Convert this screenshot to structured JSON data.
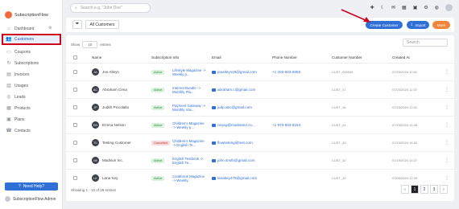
{
  "app": {
    "name": "SubscriptionFlow"
  },
  "sidebar": {
    "items": [
      {
        "label": "Dashboard",
        "icon": "home-icon"
      },
      {
        "label": "Customers",
        "icon": "users-icon",
        "active": true
      },
      {
        "label": "Coupons",
        "icon": "coupon-icon"
      },
      {
        "label": "Subscriptions",
        "icon": "subscriptions-icon"
      },
      {
        "label": "Invoices",
        "icon": "invoice-icon"
      },
      {
        "label": "Usages",
        "icon": "usage-icon"
      },
      {
        "label": "Leads",
        "icon": "leads-icon"
      },
      {
        "label": "Products",
        "icon": "products-icon"
      },
      {
        "label": "Plans",
        "icon": "plans-icon"
      },
      {
        "label": "Contacts",
        "icon": "contacts-icon"
      }
    ],
    "help_label": "Need Help?",
    "admin_name": "SubscriptionFlow Admin"
  },
  "topbar": {
    "search_placeholder": "Search e.g. \"John Doe\""
  },
  "toolbar": {
    "all_customers": "All Customers",
    "create_customer": "Create Customer",
    "import": "Import",
    "more": "More"
  },
  "table": {
    "show_label": "Show",
    "show_value": "10",
    "entries_label": "entries",
    "search_placeholder": "Search",
    "columns": [
      "Name",
      "Subscription Info",
      "Email",
      "Phone Number",
      "Customer Number",
      "Created At"
    ],
    "rows": [
      {
        "initials": "JA",
        "name": "Joe Alleyn",
        "status": "Active",
        "status_class": "active",
        "sub": "Lifestyle Magazine -> Weekly p...",
        "email": "joealleyn15@gmail.com",
        "phone": "+1 203-503-5050",
        "number": "CUST_000049",
        "created": "07/23/2024 10:51"
      },
      {
        "initials": "AC",
        "name": "Abraham Cena",
        "status": "Active",
        "status_class": "active",
        "sub": "Internet Bundle -> Monthly Pla...",
        "email": "abraham.c@gmail.com",
        "phone": "",
        "number": "CUST_47",
        "created": "07/23/2024 12:37"
      },
      {
        "initials": "JP",
        "name": "Judith Piccolalla",
        "status": "Active",
        "status_class": "active",
        "sub": "Payment Gateway -> Monthly Vas...",
        "email": "judp.abc@gmail.com",
        "phone": "",
        "number": "CUST_46",
        "created": "07/23/2024 12:31"
      },
      {
        "initials": "EN",
        "name": "Emma Nelson",
        "status": "Active",
        "status_class": "active",
        "sub": "Children's Magazine -> Weekly p...",
        "email": "neyeg@mailinator.co...",
        "phone": "+1 973-503-9164",
        "number": "CUST_44",
        "created": "07/19/2024 14:28"
      },
      {
        "initials": "TC",
        "name": "Testing Customer",
        "status": "Cancelled",
        "status_class": "cancelled",
        "sub": "Children's Magazine -> English Te...",
        "email": "flowtesting@test.com",
        "phone": "",
        "number": "CUST_43",
        "created": "07/19/2024 14:52"
      },
      {
        "initials": "MI",
        "name": "Madison Inc.",
        "status": "Active",
        "status_class": "active",
        "sub": "English Textbook -> English Te...",
        "email": "john.smith@gmail.com",
        "phone": "",
        "number": "CUST_42",
        "created": "07/19/2024 14:27"
      },
      {
        "initials": "LK",
        "name": "Lana Key",
        "status": "Active",
        "status_class": "active",
        "sub": "Cookbook Magazine -> Weekly",
        "email": "lanakey478@gmail.com",
        "phone": "",
        "number": "CUST_41",
        "created": "07/09/2024 12:29"
      }
    ],
    "footer": "Showing 1 - 10 of 26 entries",
    "pages": [
      "‹",
      "1",
      "2",
      "3",
      "›"
    ]
  }
}
